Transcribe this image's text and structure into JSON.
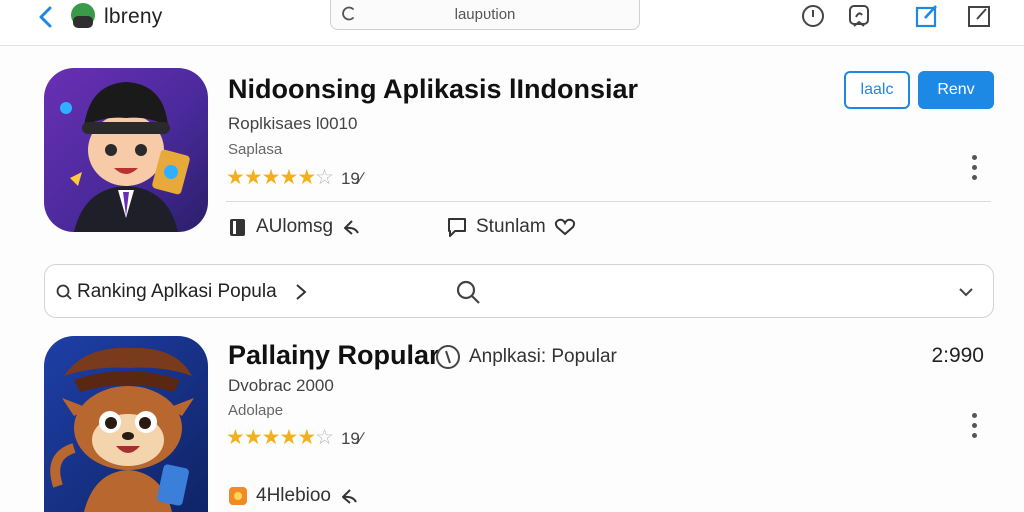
{
  "topbar": {
    "brand": "lbreny",
    "search_text": "laupᴜtion"
  },
  "app1": {
    "title": "Nidoonsing Aplikasis lIndonsiar",
    "subtitle": "Roplkisaes l0010",
    "category": "Saplasa",
    "rating_count": "19∕",
    "stars": 4.5,
    "buttons": {
      "outline": "laalc",
      "fill": "Renv"
    },
    "actions": {
      "left": "AUlomsg",
      "right": "Stunlam"
    }
  },
  "ranking": {
    "label": "Ranking Aplkasi Popula"
  },
  "app2": {
    "title": "Pallaiηy Ropular",
    "badge_text": "Anplkasi: Popular",
    "price": "2:990",
    "subtitle": "Dvobrac 2000",
    "category": "Adolape",
    "rating_count": "19∕",
    "stars": 4.5,
    "action": "4Hlebioo"
  },
  "colors": {
    "accent": "#1e88e5",
    "star": "#f2b01e"
  }
}
